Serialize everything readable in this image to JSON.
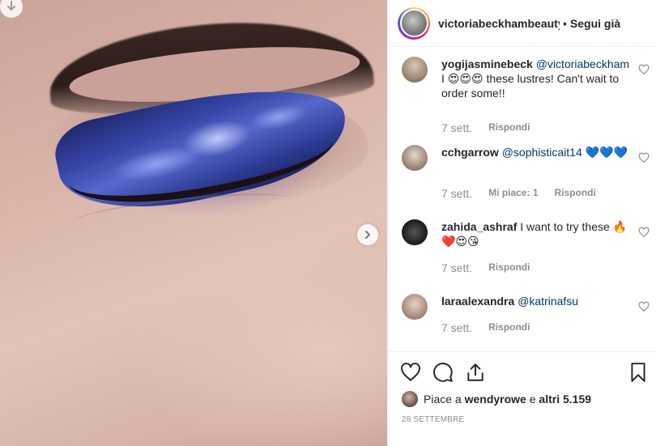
{
  "post": {
    "username": "victoriabeckhambeauty",
    "separator": "•",
    "follow_label": "Segui già"
  },
  "comments": [
    {
      "username": "yogijasminebeck",
      "mention": "@victoriabeckham",
      "text_before": "I",
      "emoji": "😍😍😍",
      "text_after": "these lustres! Can't wait to order some!!",
      "time": "7 sett.",
      "likes_label": "",
      "reply_label": "Rispondi"
    },
    {
      "username": "cchgarrow",
      "mention": "@sophisticait14",
      "text_before": "",
      "emoji": "💙💙💙",
      "text_after": "",
      "time": "7 sett.",
      "likes_label": "Mi piace: 1",
      "reply_label": "Rispondi"
    },
    {
      "username": "zahida_ashraf",
      "mention": "",
      "text_before": "I want to try these",
      "emoji": "🔥❤️😍😘",
      "text_after": "",
      "time": "7 sett.",
      "likes_label": "",
      "reply_label": "Rispondi"
    },
    {
      "username": "laraalexandra",
      "mention": "@katrinafsu",
      "text_before": "",
      "emoji": "",
      "text_after": "",
      "time": "7 sett.",
      "likes_label": "",
      "reply_label": "Rispondi"
    }
  ],
  "likes": {
    "prefix": "Piace a",
    "user": "wendyrowe",
    "connector": "e",
    "others": "altri 5.159"
  },
  "date": "28 SETTEMBRE",
  "icons": {
    "like": "heart-icon",
    "comment": "comment-icon",
    "share": "share-icon",
    "save": "bookmark-icon",
    "next": "chevron-right-icon",
    "download": "arrow-down-icon"
  },
  "colors": {
    "text": "#262626",
    "muted": "#8e8e8e",
    "mention": "#00376b",
    "border": "#efefef"
  }
}
